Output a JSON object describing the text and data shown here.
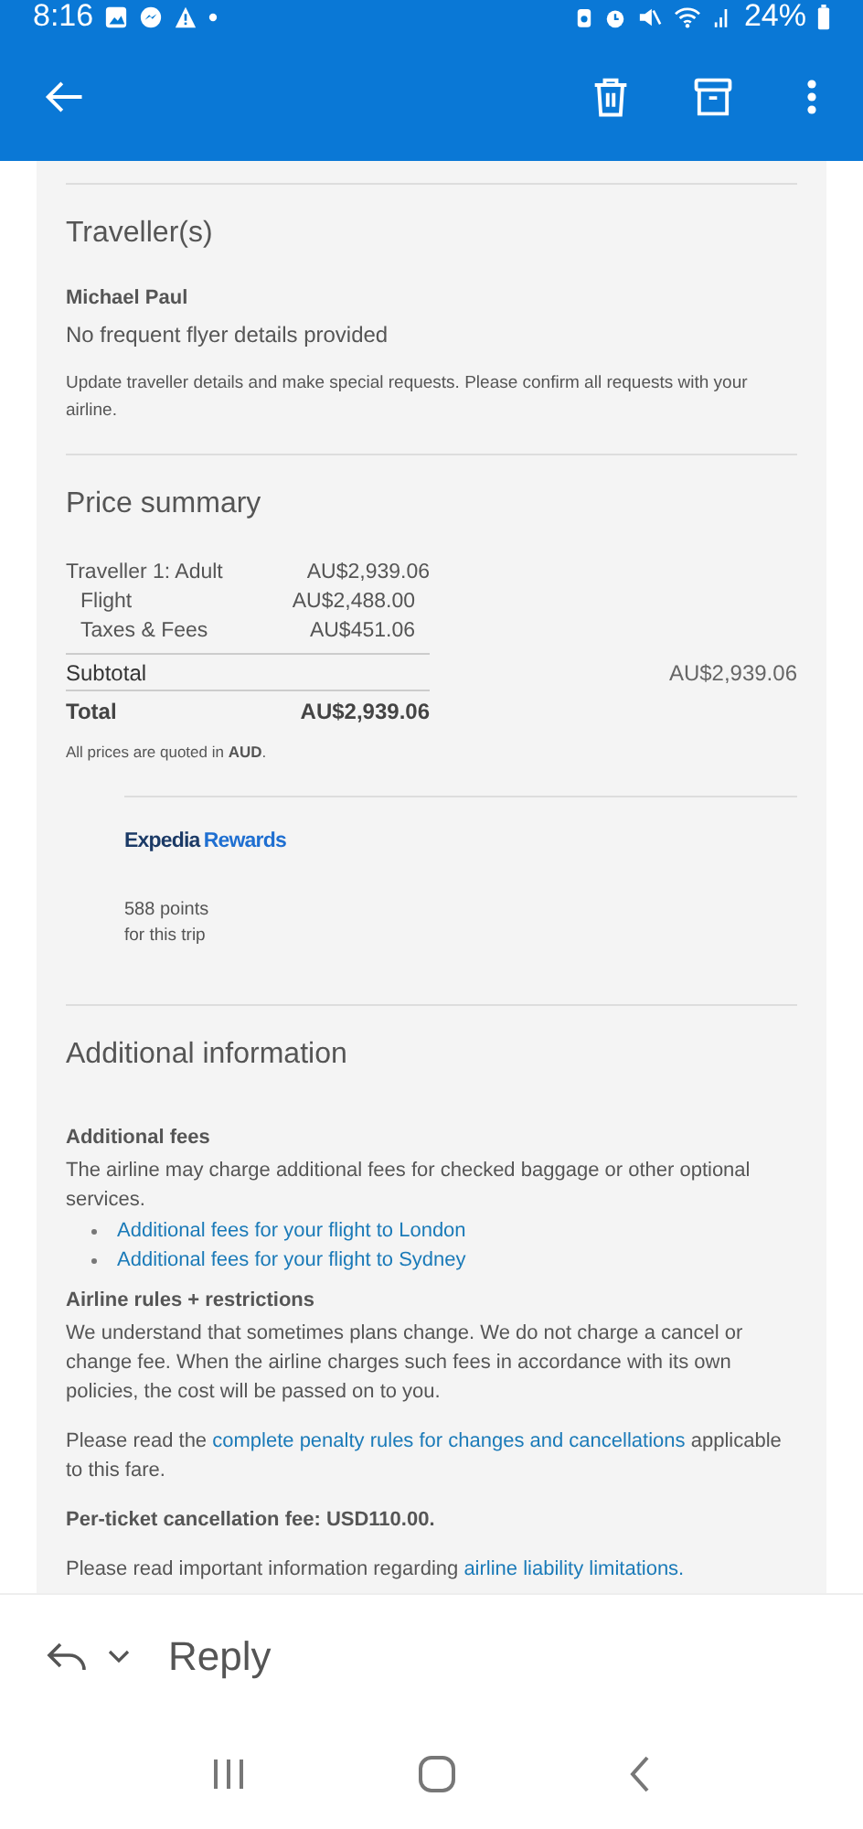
{
  "status_bar": {
    "time": "8:16",
    "battery": "24%"
  },
  "travellers": {
    "heading": "Traveller(s)",
    "name": "Michael Paul",
    "frequent_flyer": "No frequent flyer details provided",
    "note": "Update traveller details and make special requests. Please confirm all requests with your airline."
  },
  "price_summary": {
    "heading": "Price summary",
    "rows": [
      {
        "kind": "line",
        "label": "Traveller 1: Adult",
        "amount": "AU$2,939.06"
      },
      {
        "kind": "sub",
        "label": "Flight",
        "amount": "AU$2,488.00"
      },
      {
        "kind": "sub",
        "label": "Taxes & Fees",
        "amount": "AU$451.06"
      },
      {
        "kind": "subtotal",
        "label": "Subtotal",
        "amount": "AU$2,939.06"
      },
      {
        "kind": "total",
        "label": "Total",
        "amount": "AU$2,939.06"
      }
    ],
    "note": "All prices are quoted in **AUD**."
  },
  "rewards": {
    "brand": "Expedia",
    "program": "Rewards",
    "points": "588 points",
    "points_note": "for this trip"
  },
  "additional_info": {
    "heading": "Additional information",
    "blocks": [
      {
        "kind": "subheading",
        "text": "Additional fees"
      },
      {
        "kind": "paragraph",
        "parts": [
          {
            "text": "The airline may charge additional fees for checked baggage or other optional services.",
            "kind": "text"
          }
        ]
      },
      {
        "kind": "links",
        "items": [
          "Additional fees for your flight to London",
          "Additional fees for your flight to Sydney"
        ]
      },
      {
        "kind": "subheading",
        "text": "Airline rules + restrictions"
      },
      {
        "kind": "paragraph",
        "parts": [
          {
            "text": "We understand that sometimes plans change. We do not charge a cancel or change fee. When the airline charges such fees in accordance with its own policies, the cost will be passed on to you.",
            "kind": "text"
          }
        ]
      },
      {
        "kind": "paragraph",
        "parts": [
          {
            "text": "Please read the ",
            "kind": "text"
          },
          {
            "text": "complete penalty rules for changes and cancellations",
            "kind": "link"
          },
          {
            "text": " applicable to this fare.",
            "kind": "text"
          }
        ]
      },
      {
        "kind": "strong",
        "text": "Per-ticket cancellation fee: USD110.00."
      },
      {
        "kind": "paragraph",
        "parts": [
          {
            "text": "Please read important information regarding ",
            "kind": "text"
          },
          {
            "text": "airline liability limitations.",
            "kind": "link"
          }
        ]
      }
    ]
  },
  "reply_bar": {
    "label": "Reply"
  }
}
